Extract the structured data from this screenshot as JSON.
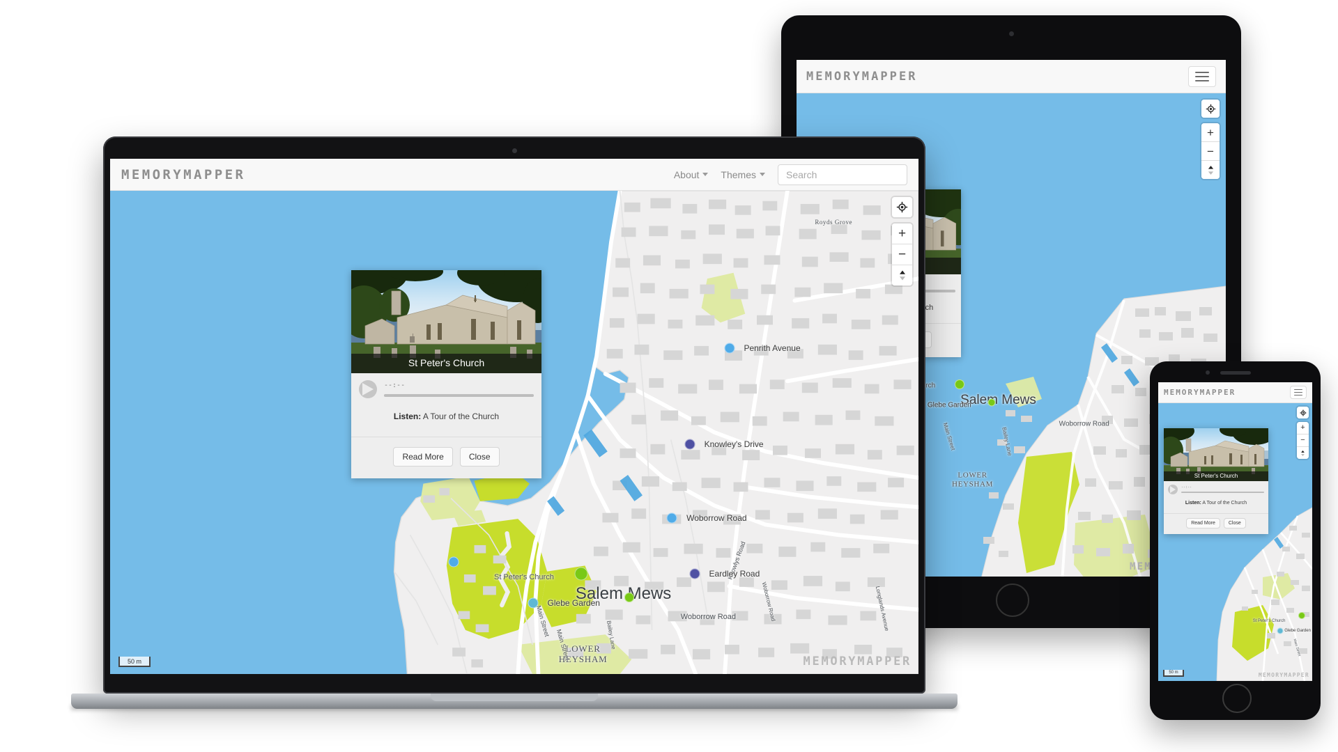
{
  "app": {
    "brand": "MEMORYMAPPER",
    "watermark": "MEMORYMAPPER"
  },
  "navbar": {
    "about_label": "About",
    "themes_label": "Themes",
    "search_placeholder": "Search",
    "menu_icon": "hamburger-icon"
  },
  "map": {
    "scale_label": "50 m",
    "controls": [
      {
        "name": "geolocate-icon",
        "title": "Find my location"
      },
      {
        "name": "zoom-in-icon",
        "title": "Zoom in",
        "glyph": "+"
      },
      {
        "name": "zoom-out-icon",
        "title": "Zoom out",
        "glyph": "−"
      },
      {
        "name": "compass-icon",
        "title": "Reset bearing / pitch"
      }
    ],
    "colors": {
      "water": "#75bce8",
      "land": "#f0efef",
      "building": "#d6d6d6",
      "park": "#c7dd2c",
      "park_light": "#dfeaa4",
      "road": "#ffffff",
      "marker_light": "#4fabe8",
      "marker_dark": "#4f51a3",
      "marker_teal": "#5fb8d4",
      "marker_green": "#79c916"
    },
    "markers": [
      {
        "label": "Penrith Avenue",
        "color": "light"
      },
      {
        "label": "Knowley's Drive",
        "color": "dark"
      },
      {
        "label": "Woborrow Road",
        "color": "light"
      },
      {
        "label": "Eardley Road",
        "color": "dark"
      },
      {
        "label": "Glebe Garden",
        "color": "teal"
      }
    ],
    "labels": [
      "Salem Mews",
      "St Peter's Church",
      "LOWER HEYSHAM",
      "Royds Grove",
      "Woborrow Road",
      "Knowlys Road",
      "Main Street",
      "Bailey Lane",
      "Longlands Avenue"
    ]
  },
  "popup": {
    "image_caption": "St Peter's Church",
    "image_alt": "st-peters-church-photo",
    "audio_time": "--:--",
    "listen_label": "Listen:",
    "listen_title": "A Tour of the Church",
    "read_more_label": "Read More",
    "close_label": "Close"
  }
}
